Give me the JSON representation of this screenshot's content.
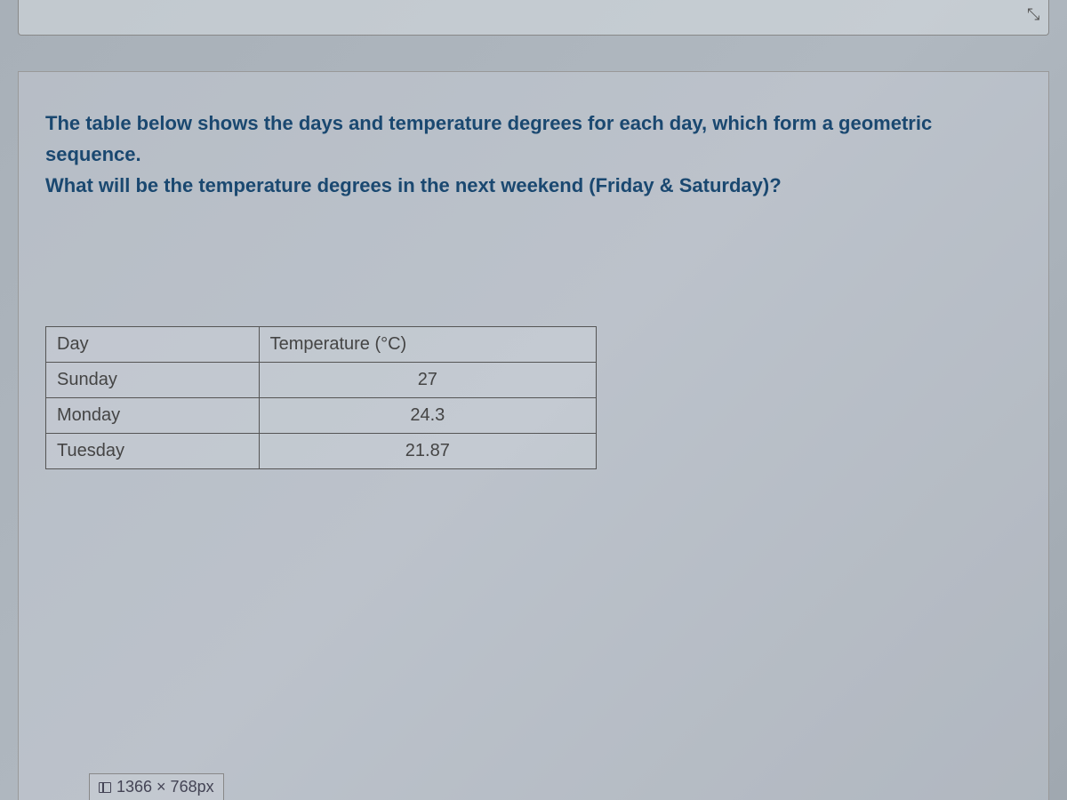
{
  "question": {
    "line1": "The table below shows the days and temperature degrees for each day, which form a geometric sequence.",
    "line2": "What will be the temperature degrees in the next weekend (Friday & Saturday)?"
  },
  "table": {
    "headers": {
      "day": "Day",
      "temp": "Temperature (°C)"
    },
    "rows": [
      {
        "day": "Sunday",
        "temp": "27"
      },
      {
        "day": "Monday",
        "temp": "24.3"
      },
      {
        "day": "Tuesday",
        "temp": "21.87"
      }
    ]
  },
  "footer": {
    "dimensions": "1366 × 768px"
  }
}
